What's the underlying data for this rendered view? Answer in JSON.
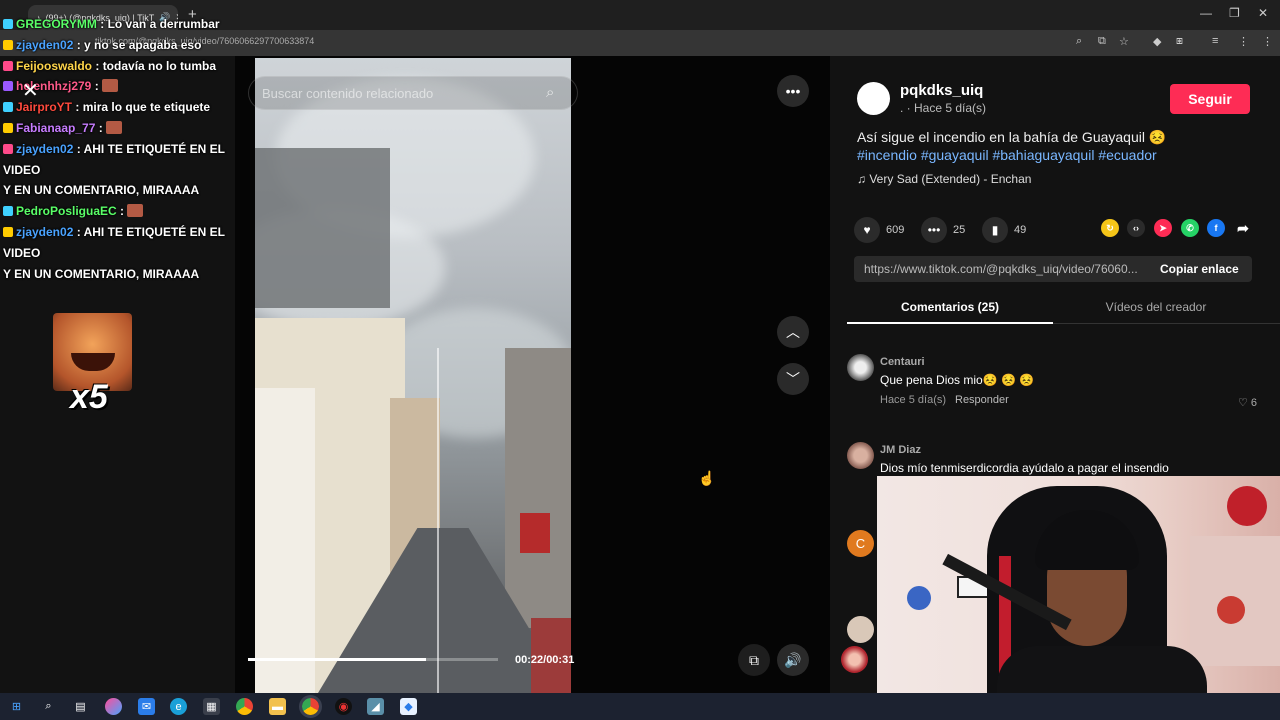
{
  "browser": {
    "tab_title": "(99+) (@pqkdks_uiq) | TikT",
    "url": "tiktok.com/@pqkdks_uiq/video/7606066297700633874",
    "new_tab": "+",
    "window_controls": {
      "minimize": "—",
      "restore": "❐",
      "close": "✕"
    }
  },
  "chat": {
    "messages": [
      {
        "user": "GREGORYMM",
        "text": ": Lo van a derrumbar",
        "color": "#5aff68"
      },
      {
        "user": "zjayden02",
        "text": ": y no se apagaba eso",
        "color": "#4aa3ff"
      },
      {
        "user": "Feijooswaldo",
        "text": ": todavía no lo tumba",
        "color": "#ffd54a"
      },
      {
        "user": "helenhhzj279",
        "text": ":",
        "color": "#ff5a8a",
        "emote": true
      },
      {
        "user": "JairproYT",
        "text": ": mira lo que te etiquete",
        "color": "#ff4a3d"
      },
      {
        "user": "Fabianaap_77",
        "text": ":",
        "color": "#c77dff",
        "emote": true
      },
      {
        "user": "zjayden02",
        "text": ": AHI TE ETIQUETÉ EN EL VIDEO",
        "color": "#4aa3ff"
      },
      {
        "user": "",
        "text": "Y EN UN COMENTARIO, MIRAAAA",
        "color": "#fff"
      },
      {
        "user": "PedroPosliguaEC",
        "text": ":",
        "color": "#5aff68",
        "emote": true
      },
      {
        "user": "zjayden02",
        "text": ": AHI TE ETIQUETÉ EN EL VIDEO",
        "color": "#4aa3ff"
      },
      {
        "user": "",
        "text": "Y EN UN COMENTARIO, MIRAAAA",
        "color": "#fff"
      }
    ],
    "multiplier": "x5"
  },
  "video": {
    "search_placeholder": "Buscar contenido relacionado",
    "time": "00:22/00:31",
    "progress": 0.71
  },
  "post": {
    "username": "pqkdks_uiq",
    "posted": ". · Hace 5 día(s)",
    "follow_label": "Seguir",
    "caption_text": "Así sigue el incendio en la bahía de Guayaquil 😣 ",
    "tags": [
      "#incendio",
      "#guayaquil",
      "#bahiaguayaquil",
      "#ecuador"
    ],
    "music": "Very Sad (Extended) - Enchan",
    "likes": "609",
    "comments": "25",
    "saves": "49",
    "link": "https://www.tiktok.com/@pqkdks_uiq/video/76060...",
    "copy_label": "Copiar enlace"
  },
  "tabs": {
    "comments": "Comentarios (25)",
    "creator": "Vídeos del creador"
  },
  "comments": [
    {
      "user": "Centauri",
      "text": "Que pena Dios mio😣 😣 😣",
      "time": "Hace 5 día(s)",
      "reply": "Responder",
      "likes": "6"
    },
    {
      "user": "JM Diaz",
      "text": "Dios mío tenmiserdicordia ayúdalo a pagar el insendio"
    }
  ],
  "comment_avatar_letter": "C",
  "colors": {
    "accent": "#fe2c55",
    "hashtag": "#7ab7ff"
  }
}
